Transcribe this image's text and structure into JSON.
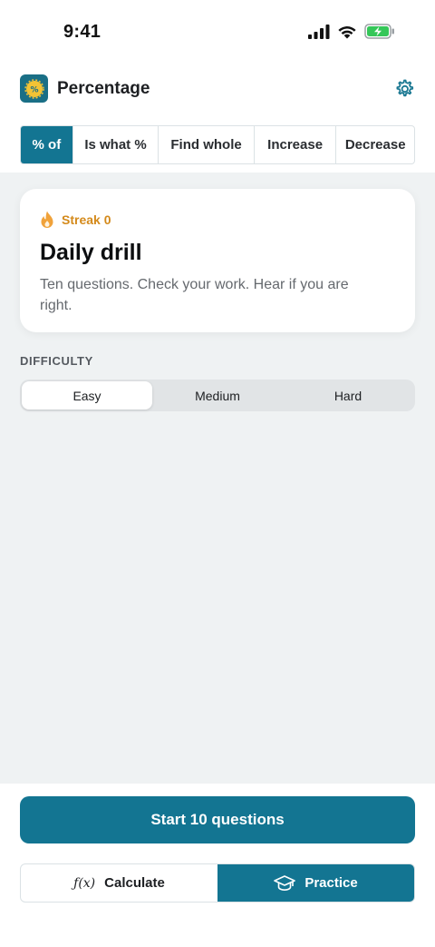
{
  "status_bar": {
    "time": "9:41"
  },
  "app": {
    "title": "Percentage",
    "colors": {
      "accent": "#137592",
      "streak": "#d48a1b"
    }
  },
  "tabs": [
    {
      "label": "% of",
      "active": true
    },
    {
      "label": "Is what %",
      "active": false
    },
    {
      "label": "Find whole",
      "active": false
    },
    {
      "label": "Increase",
      "active": false
    },
    {
      "label": "Decrease",
      "active": false
    }
  ],
  "drill_card": {
    "streak": "Streak 0",
    "title": "Daily drill",
    "description": "Ten questions. Check your work. Hear if you are right."
  },
  "difficulty": {
    "label": "DIFFICULTY",
    "options": [
      "Easy",
      "Medium",
      "Hard"
    ],
    "selected": "Easy"
  },
  "start_button": "Start 10 questions",
  "modes": {
    "calculate": {
      "icon_text": "ƒ(x)",
      "label": "Calculate"
    },
    "practice": {
      "label": "Practice"
    },
    "active": "Practice"
  }
}
